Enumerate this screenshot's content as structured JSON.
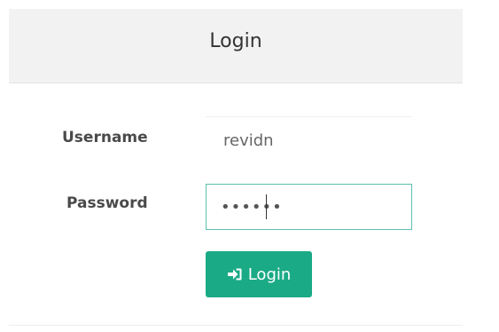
{
  "panel": {
    "title": "Login"
  },
  "form": {
    "username_label": "Username",
    "username_value": "revidn",
    "password_label": "Password",
    "password_value": "••••••",
    "submit_label": "Login",
    "submit_icon": "sign-in-icon"
  },
  "colors": {
    "accent": "#1aaa86",
    "focus_border": "#5bbfae",
    "header_bg": "#f2f2f2"
  }
}
